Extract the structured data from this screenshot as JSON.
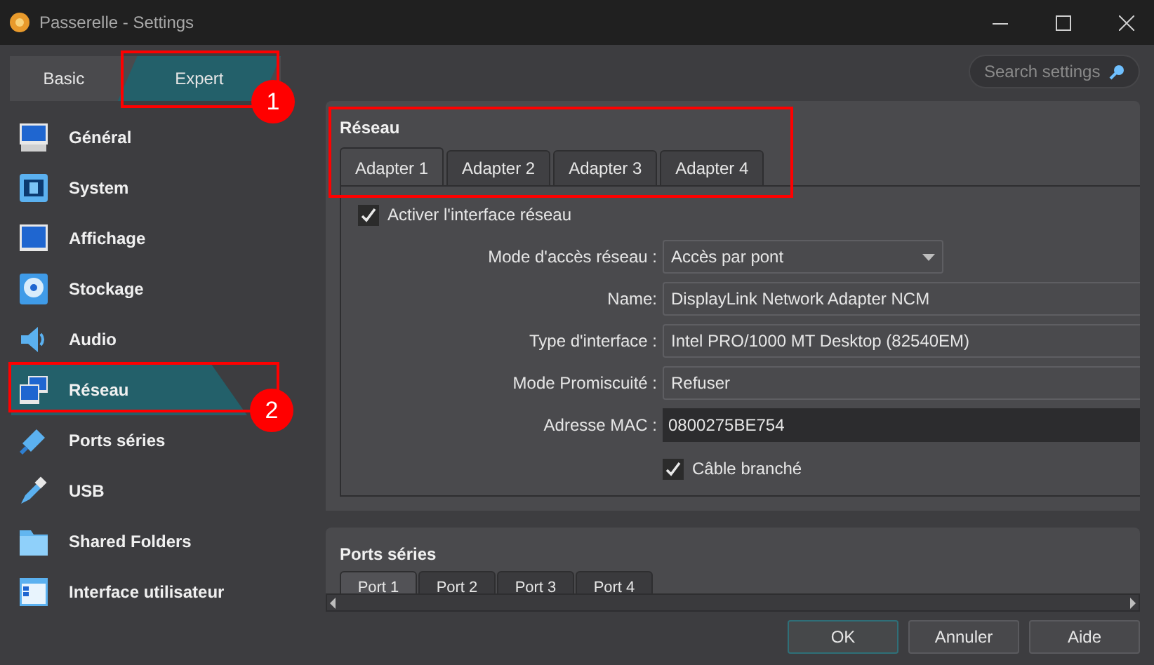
{
  "window": {
    "title": "Passerelle - Settings"
  },
  "modes": [
    {
      "label": "Basic",
      "selected": false
    },
    {
      "label": "Expert",
      "selected": true
    }
  ],
  "search": {
    "placeholder": "Search settings"
  },
  "sidebar": {
    "items": [
      {
        "label": "Général",
        "selected": false
      },
      {
        "label": "System",
        "selected": false
      },
      {
        "label": "Affichage",
        "selected": false
      },
      {
        "label": "Stockage",
        "selected": false
      },
      {
        "label": "Audio",
        "selected": false
      },
      {
        "label": "Réseau",
        "selected": true
      },
      {
        "label": "Ports séries",
        "selected": false
      },
      {
        "label": "USB",
        "selected": false
      },
      {
        "label": "Shared Folders",
        "selected": false
      },
      {
        "label": "Interface utilisateur",
        "selected": false
      }
    ]
  },
  "network": {
    "title": "Réseau",
    "tabs": [
      {
        "label": "Adapter 1",
        "selected": true
      },
      {
        "label": "Adapter 2",
        "selected": false
      },
      {
        "label": "Adapter 3",
        "selected": false
      },
      {
        "label": "Adapter 4",
        "selected": false
      }
    ],
    "enable": {
      "label": "Activer l'interface réseau",
      "checked": true
    },
    "fields": [
      {
        "label": "Mode d'accès réseau :",
        "value": "Accès par pont",
        "kind": "dropdown"
      },
      {
        "label": "Name:",
        "value": "DisplayLink Network Adapter NCM",
        "kind": "combo"
      },
      {
        "label": "Type d'interface :",
        "value": "Intel PRO/1000 MT Desktop (82540EM)",
        "kind": "combo"
      },
      {
        "label": "Mode Promiscuité :",
        "value": "Refuser",
        "kind": "combo"
      },
      {
        "label": "Adresse MAC :",
        "value": "0800275BE754",
        "kind": "input"
      }
    ],
    "cable": {
      "label": "Câble branché",
      "checked": true
    }
  },
  "serial": {
    "title": "Ports séries",
    "tabs": [
      {
        "label": "Port 1",
        "selected": true
      },
      {
        "label": "Port 2",
        "selected": false
      },
      {
        "label": "Port 3",
        "selected": false
      },
      {
        "label": "Port 4",
        "selected": false
      }
    ]
  },
  "buttons": [
    {
      "label": "OK",
      "default": true
    },
    {
      "label": "Annuler",
      "default": false
    },
    {
      "label": "Aide",
      "default": false
    }
  ],
  "annotations": [
    "1",
    "2"
  ]
}
